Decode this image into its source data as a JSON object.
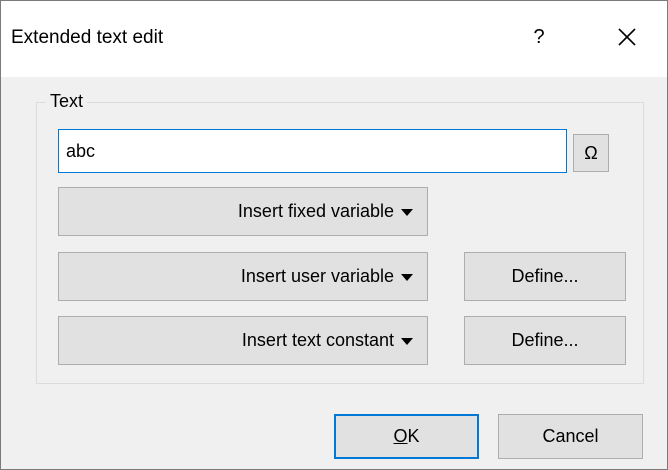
{
  "window": {
    "title": "Extended text edit",
    "help_label": "?",
    "close_icon": "close-icon"
  },
  "group": {
    "label": "Text",
    "text_value": "abc",
    "omega_label": "Ω"
  },
  "buttons": {
    "insert_fixed_variable": "Insert fixed variable",
    "insert_user_variable": "Insert user variable",
    "insert_text_constant": "Insert text constant",
    "define_user_variable": "Define...",
    "define_text_constant": "Define...",
    "ok_accel": "O",
    "ok_rest": "K",
    "cancel": "Cancel"
  },
  "colors": {
    "dialog_background": "#f0f0f0",
    "titlebar_background": "#ffffff",
    "button_face": "#e1e1e1",
    "button_border": "#adadad",
    "focus_accent": "#0078d7"
  }
}
